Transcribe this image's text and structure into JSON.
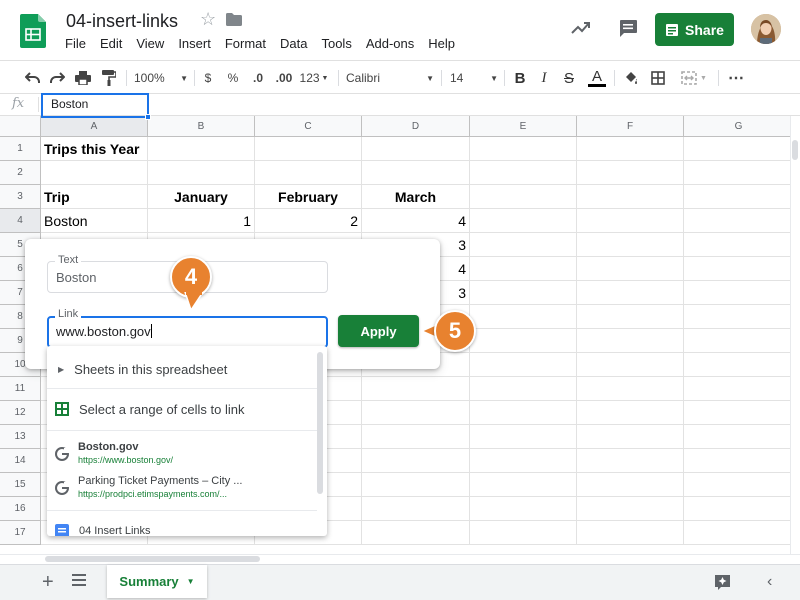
{
  "header": {
    "doc_title": "04-insert-links",
    "menu": [
      "File",
      "Edit",
      "View",
      "Insert",
      "Format",
      "Data",
      "Tools",
      "Add-ons",
      "Help"
    ],
    "share_label": "Share"
  },
  "toolbar": {
    "zoom": "100%",
    "currency": "$",
    "percent": "%",
    "dec_decrease": ".0",
    "dec_increase": ".00",
    "more_formats": "123",
    "font": "Calibri",
    "font_size": "14"
  },
  "formula_bar": {
    "fx": "fx",
    "value": "Boston"
  },
  "grid": {
    "columns": [
      "A",
      "B",
      "C",
      "D",
      "E",
      "F",
      "G"
    ],
    "rows": [
      "1",
      "2",
      "3",
      "4",
      "5",
      "6",
      "7",
      "8",
      "9",
      "10",
      "11",
      "12",
      "13",
      "14",
      "15",
      "16",
      "17"
    ],
    "cells": {
      "A1": "Trips this Year",
      "A3": "Trip",
      "B3": "January",
      "C3": "February",
      "D3": "March",
      "A4": "Boston",
      "B4": "1",
      "C4": "2",
      "D4": "4",
      "D5": "3",
      "D6": "4",
      "D7": "3"
    }
  },
  "link_dialog": {
    "text_label": "Text",
    "text_value": "Boston",
    "link_label": "Link",
    "link_value": "www.boston.gov",
    "apply_label": "Apply"
  },
  "link_suggestions": {
    "sheets_label": "Sheets in this spreadsheet",
    "range_label": "Select a range of cells to link",
    "results": [
      {
        "title": "Boston.gov",
        "url": "https://www.boston.gov/"
      },
      {
        "title": "Parking Ticket Payments – City ...",
        "url": "https://prodpci.etimspayments.com/..."
      }
    ],
    "doc_label": "04 Insert Links"
  },
  "callouts": {
    "step4": "4",
    "step5": "5"
  },
  "sheet_tabs": {
    "active": "Summary"
  },
  "colors": {
    "brand_green": "#188038",
    "selection_blue": "#1a73e8",
    "callout_orange": "#e8822f"
  },
  "icons": {
    "logo": "sheets-logo-icon",
    "star": "star-icon",
    "folder": "folder-icon",
    "trend": "activity-trend-icon",
    "comment": "comment-icon",
    "add_sheet": "plus-icon",
    "all_sheets": "list-icon",
    "explore": "explore-icon"
  }
}
